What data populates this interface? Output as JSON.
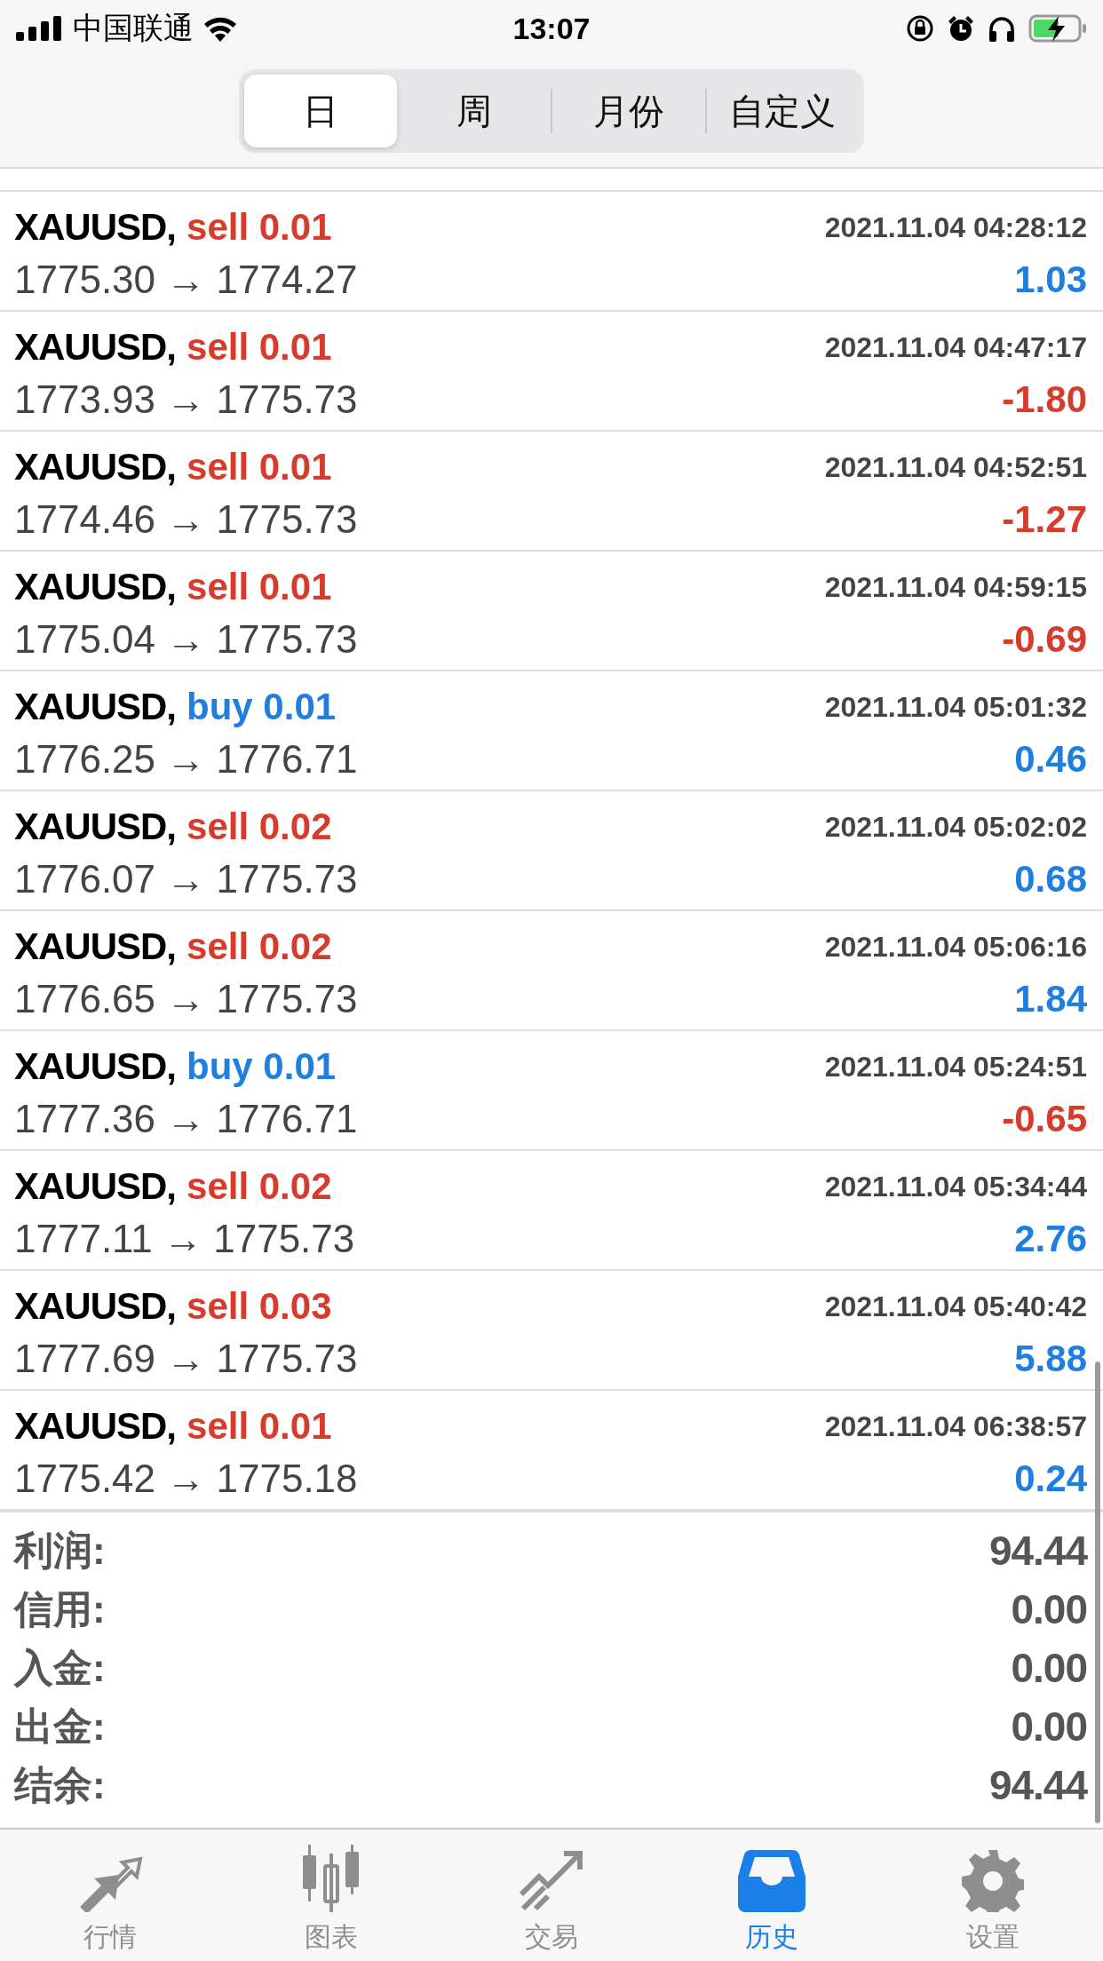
{
  "status_bar": {
    "carrier": "中国联通",
    "time": "13:07"
  },
  "period_tabs": [
    {
      "label": "日",
      "selected": true
    },
    {
      "label": "周",
      "selected": false
    },
    {
      "label": "月份",
      "selected": false
    },
    {
      "label": "自定义",
      "selected": false
    }
  ],
  "deals": [
    {
      "symbol": "XAUUSD,",
      "order": {
        "kind": "sell",
        "text": "sell 0.01"
      },
      "time": "2021.11.04 04:28:12",
      "prices": "1775.30 → 1774.27",
      "profit": {
        "kind": "gain",
        "text": "1.03"
      }
    },
    {
      "symbol": "XAUUSD,",
      "order": {
        "kind": "sell",
        "text": "sell 0.01"
      },
      "time": "2021.11.04 04:47:17",
      "prices": "1773.93 → 1775.73",
      "profit": {
        "kind": "loss",
        "text": "-1.80"
      }
    },
    {
      "symbol": "XAUUSD,",
      "order": {
        "kind": "sell",
        "text": "sell 0.01"
      },
      "time": "2021.11.04 04:52:51",
      "prices": "1774.46 → 1775.73",
      "profit": {
        "kind": "loss",
        "text": "-1.27"
      }
    },
    {
      "symbol": "XAUUSD,",
      "order": {
        "kind": "sell",
        "text": "sell 0.01"
      },
      "time": "2021.11.04 04:59:15",
      "prices": "1775.04 → 1775.73",
      "profit": {
        "kind": "loss",
        "text": "-0.69"
      }
    },
    {
      "symbol": "XAUUSD,",
      "order": {
        "kind": "buy",
        "text": "buy 0.01"
      },
      "time": "2021.11.04 05:01:32",
      "prices": "1776.25 → 1776.71",
      "profit": {
        "kind": "gain",
        "text": "0.46"
      }
    },
    {
      "symbol": "XAUUSD,",
      "order": {
        "kind": "sell",
        "text": "sell 0.02"
      },
      "time": "2021.11.04 05:02:02",
      "prices": "1776.07 → 1775.73",
      "profit": {
        "kind": "gain",
        "text": "0.68"
      }
    },
    {
      "symbol": "XAUUSD,",
      "order": {
        "kind": "sell",
        "text": "sell 0.02"
      },
      "time": "2021.11.04 05:06:16",
      "prices": "1776.65 → 1775.73",
      "profit": {
        "kind": "gain",
        "text": "1.84"
      }
    },
    {
      "symbol": "XAUUSD,",
      "order": {
        "kind": "buy",
        "text": "buy 0.01"
      },
      "time": "2021.11.04 05:24:51",
      "prices": "1777.36 → 1776.71",
      "profit": {
        "kind": "loss",
        "text": "-0.65"
      }
    },
    {
      "symbol": "XAUUSD,",
      "order": {
        "kind": "sell",
        "text": "sell 0.02"
      },
      "time": "2021.11.04 05:34:44",
      "prices": "1777.11 → 1775.73",
      "profit": {
        "kind": "gain",
        "text": "2.76"
      }
    },
    {
      "symbol": "XAUUSD,",
      "order": {
        "kind": "sell",
        "text": "sell 0.03"
      },
      "time": "2021.11.04 05:40:42",
      "prices": "1777.69 → 1775.73",
      "profit": {
        "kind": "gain",
        "text": "5.88"
      }
    },
    {
      "symbol": "XAUUSD,",
      "order": {
        "kind": "sell",
        "text": "sell 0.01"
      },
      "time": "2021.11.04 06:38:57",
      "prices": "1775.42 → 1775.18",
      "profit": {
        "kind": "gain",
        "text": "0.24"
      }
    }
  ],
  "summary": [
    {
      "label": "利润:",
      "value": "94.44"
    },
    {
      "label": "信用:",
      "value": "0.00"
    },
    {
      "label": "入金:",
      "value": "0.00"
    },
    {
      "label": "出金:",
      "value": "0.00"
    },
    {
      "label": "结余:",
      "value": "94.44"
    }
  ],
  "tab_bar": [
    {
      "label": "行情",
      "selected": false
    },
    {
      "label": "图表",
      "selected": false
    },
    {
      "label": "交易",
      "selected": false
    },
    {
      "label": "历史",
      "selected": true
    },
    {
      "label": "设置",
      "selected": false
    }
  ]
}
